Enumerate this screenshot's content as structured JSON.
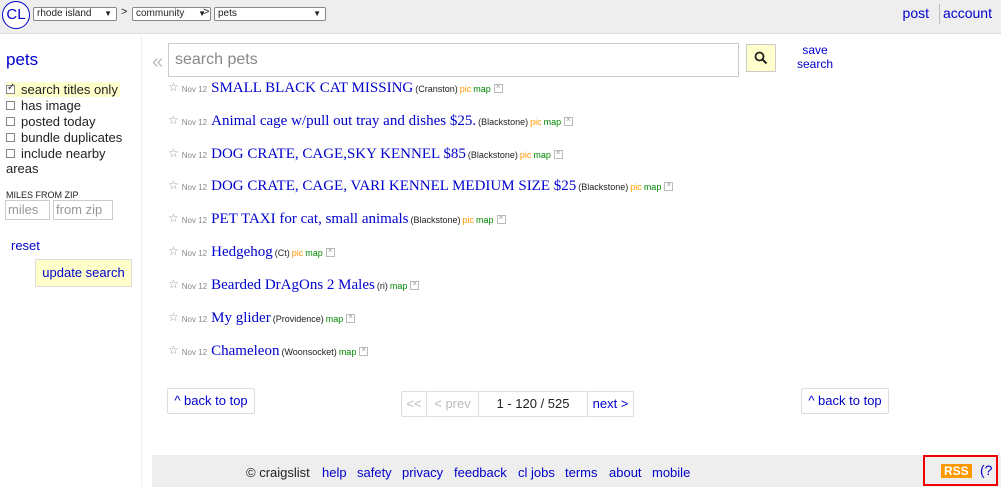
{
  "header": {
    "logo": "CL",
    "area": "rhode island",
    "category": "community",
    "subcategory": "pets",
    "crumb_sep": ">",
    "post": "post",
    "account": "account"
  },
  "sidebar": {
    "title": "pets",
    "options": [
      {
        "label": "search titles only",
        "checked": true
      },
      {
        "label": "has image",
        "checked": false
      },
      {
        "label": "posted today",
        "checked": false
      },
      {
        "label": "bundle duplicates",
        "checked": false
      },
      {
        "label": "include nearby",
        "checked": false
      }
    ],
    "areas_label": "areas",
    "miles_label": "MILES FROM ZIP",
    "miles_placeholder": "miles",
    "zip_placeholder": "from zip",
    "reset": "reset",
    "update": "update search"
  },
  "search": {
    "placeholder": "search pets",
    "save_line1": "save",
    "save_line2": "search"
  },
  "listings": [
    {
      "date": "Nov 12",
      "title": "SMALL BLACK CAT MISSING",
      "loc": "(Cranston)",
      "pic": "pic",
      "map": "map"
    },
    {
      "date": "Nov 12",
      "title": "Animal cage w/pull out tray and dishes $25.",
      "loc": "(Blackstone)",
      "pic": "pic",
      "map": "map"
    },
    {
      "date": "Nov 12",
      "title": "DOG CRATE, CAGE,SKY KENNEL $85",
      "loc": "(Blackstone)",
      "pic": "pic",
      "map": "map"
    },
    {
      "date": "Nov 12",
      "title": "DOG CRATE, CAGE, VARI KENNEL MEDIUM SIZE $25",
      "loc": "(Blackstone)",
      "pic": "pic",
      "map": "map"
    },
    {
      "date": "Nov 12",
      "title": "PET TAXI for cat, small animals",
      "loc": "(Blackstone)",
      "pic": "pic",
      "map": "map"
    },
    {
      "date": "Nov 12",
      "title": "Hedgehog",
      "loc": "(Ct)",
      "pic": "pic",
      "map": "map"
    },
    {
      "date": "Nov 12",
      "title": "Bearded DrAgOns 2 Males",
      "loc": "(ri)",
      "pic": "",
      "map": "map"
    },
    {
      "date": "Nov 12",
      "title": "My glider",
      "loc": "(Providence)",
      "pic": "",
      "map": "map"
    },
    {
      "date": "Nov 12",
      "title": "Chameleon",
      "loc": "(Woonsocket)",
      "pic": "",
      "map": "map"
    }
  ],
  "pager": {
    "back_to_top": "^ back to top",
    "first": "<<",
    "prev": "< prev",
    "range": "1 - 120 / 525",
    "next": "next >"
  },
  "footer": {
    "copyright": "© craigslist",
    "links": [
      "help",
      "safety",
      "privacy",
      "feedback",
      "cl jobs",
      "terms",
      "about",
      "mobile"
    ],
    "rss": "RSS",
    "rss_help": "(?"
  }
}
